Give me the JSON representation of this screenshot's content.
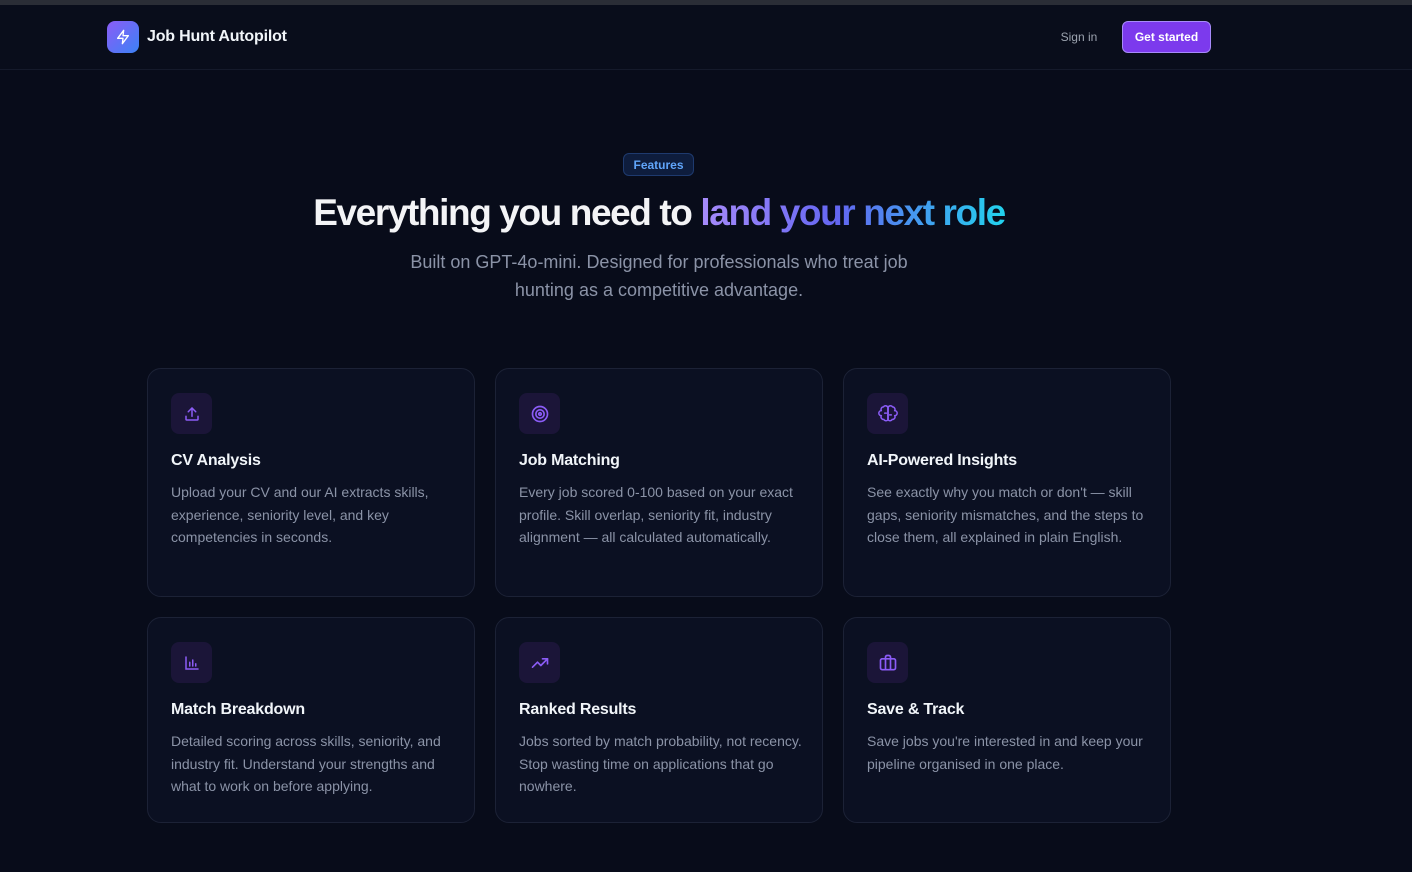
{
  "nav": {
    "brand": "Job Hunt Autopilot",
    "logo_icon": "lightning-bolt-icon",
    "sign_in": "Sign in",
    "get_started": "Get started"
  },
  "hero": {
    "badge": "Features",
    "headline_plain": "Everything you need to ",
    "headline_gradient": "land your next role",
    "subtitle": "Built on GPT-4o-mini. Designed for professionals who treat job hunting as a competitive advantage."
  },
  "features": [
    {
      "icon": "upload-icon",
      "title": "CV Analysis",
      "description": "Upload your CV and our AI extracts skills, experience, seniority level, and key competencies in seconds."
    },
    {
      "icon": "target-icon",
      "title": "Job Matching",
      "description": "Every job scored 0-100 based on your exact profile. Skill overlap, seniority fit, industry alignment — all calculated automatically."
    },
    {
      "icon": "brain-icon",
      "title": "AI-Powered Insights",
      "description": "See exactly why you match or don't — skill gaps, seniority mismatches, and the steps to close them, all explained in plain English."
    },
    {
      "icon": "bar-chart-icon",
      "title": "Match Breakdown",
      "description": "Detailed scoring across skills, seniority, and industry fit. Understand your strengths and what to work on before applying."
    },
    {
      "icon": "trending-up-icon",
      "title": "Ranked Results",
      "description": "Jobs sorted by match probability, not recency. Stop wasting time on applications that go nowhere."
    },
    {
      "icon": "briefcase-icon",
      "title": "Save & Track",
      "description": "Save jobs you're interested in and keep your pipeline organised in one place."
    }
  ],
  "colors": {
    "background": "#080c1a",
    "accent": "#7c3aed",
    "icon_color": "#8b5cf6",
    "badge_text": "#60a5fa"
  }
}
